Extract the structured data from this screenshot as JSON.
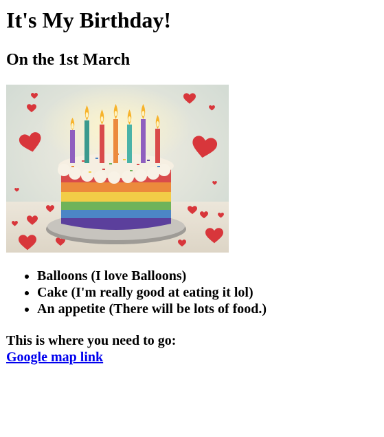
{
  "page": {
    "title": "It's My Birthday!",
    "subtitle": "On the 1st March",
    "image": {
      "alt": "Birthday cake",
      "icon": "rainbow-birthday-cake-with-candles-and-hearts",
      "colors": {
        "background": "#e9e4d6",
        "plate": "#bdbab4",
        "frosting": "#f6efe2",
        "layers": [
          "#d94b4b",
          "#ec8a3c",
          "#f2cd47",
          "#6fb35a",
          "#4c86c6",
          "#5b3f9c"
        ],
        "heart": "#d8363b",
        "flame": "#f7b32b"
      }
    },
    "items": [
      "Balloons (I love Balloons)",
      "Cake (I'm really good at eating it lol)",
      "An appetite (There will be lots of food.)"
    ],
    "directions_label": "This is where you need to go:",
    "map_link": "Google map link",
    "link_color": "#0000ee"
  }
}
